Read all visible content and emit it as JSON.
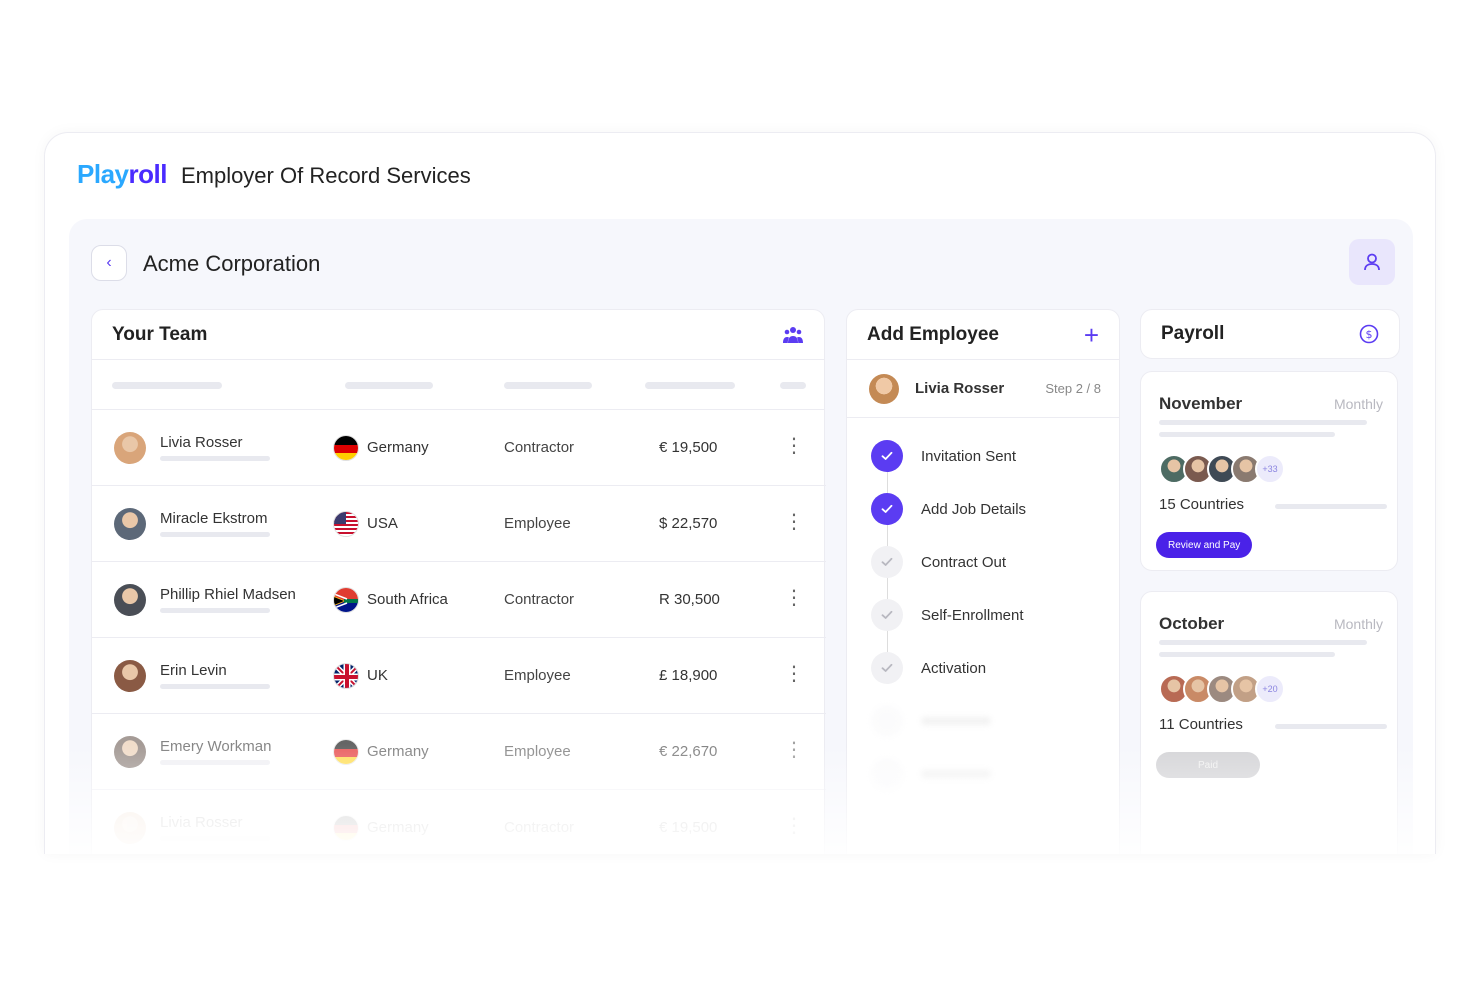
{
  "brand": {
    "logo_part1": "Play",
    "logo_part2": "roll",
    "title": "Employer Of Record Services"
  },
  "header": {
    "company": "Acme Corporation",
    "back_icon": "chevron-left-icon",
    "user_icon": "user-icon"
  },
  "team": {
    "title": "Your Team",
    "icon": "team-icon",
    "rows": [
      {
        "name": "Livia Rosser",
        "country": "Germany",
        "flag": "de",
        "role": "Contractor",
        "salary": "€ 19,500",
        "avatar_color": "#d9a57a"
      },
      {
        "name": "Miracle Ekstrom",
        "country": "USA",
        "flag": "us",
        "role": "Employee",
        "salary": "$ 22,570",
        "avatar_color": "#5c6878"
      },
      {
        "name": "Phillip Rhiel Madsen",
        "country": "South Africa",
        "flag": "za",
        "role": "Contractor",
        "salary": "R 30,500",
        "avatar_color": "#4a4e56"
      },
      {
        "name": "Erin Levin",
        "country": "UK",
        "flag": "uk",
        "role": "Employee",
        "salary": "£ 18,900",
        "avatar_color": "#8a5a44"
      },
      {
        "name": "Emery Workman",
        "country": "Germany",
        "flag": "de",
        "role": "Employee",
        "salary": "€ 22,670",
        "avatar_color": "#6a5a52"
      },
      {
        "name": "Livia Rosser",
        "country": "Germany",
        "flag": "de",
        "role": "Contractor",
        "salary": "€ 19,500",
        "avatar_color": "#d9a57a"
      }
    ]
  },
  "add_employee": {
    "title": "Add Employee",
    "employee_name": "Livia Rosser",
    "step_text": "Step 2 / 8",
    "steps": [
      {
        "label": "Invitation Sent",
        "status": "done"
      },
      {
        "label": "Add Job Details",
        "status": "done"
      },
      {
        "label": "Contract Out",
        "status": "todo"
      },
      {
        "label": "Self-Enrollment",
        "status": "todo"
      },
      {
        "label": "Activation",
        "status": "todo"
      }
    ]
  },
  "payroll": {
    "title": "Payroll",
    "icon": "dollar-circle-icon",
    "months": [
      {
        "month": "November",
        "period": "Monthly",
        "more": "+33",
        "countries": "15 Countries",
        "button": "Review and Pay",
        "button_state": "primary"
      },
      {
        "month": "October",
        "period": "Monthly",
        "more": "+20",
        "countries": "11 Countries",
        "button": "Paid",
        "button_state": "paid"
      }
    ]
  },
  "colors": {
    "accent": "#5b3cf2",
    "logo_blue": "#2aa8ff",
    "logo_purple": "#4a2bff"
  }
}
